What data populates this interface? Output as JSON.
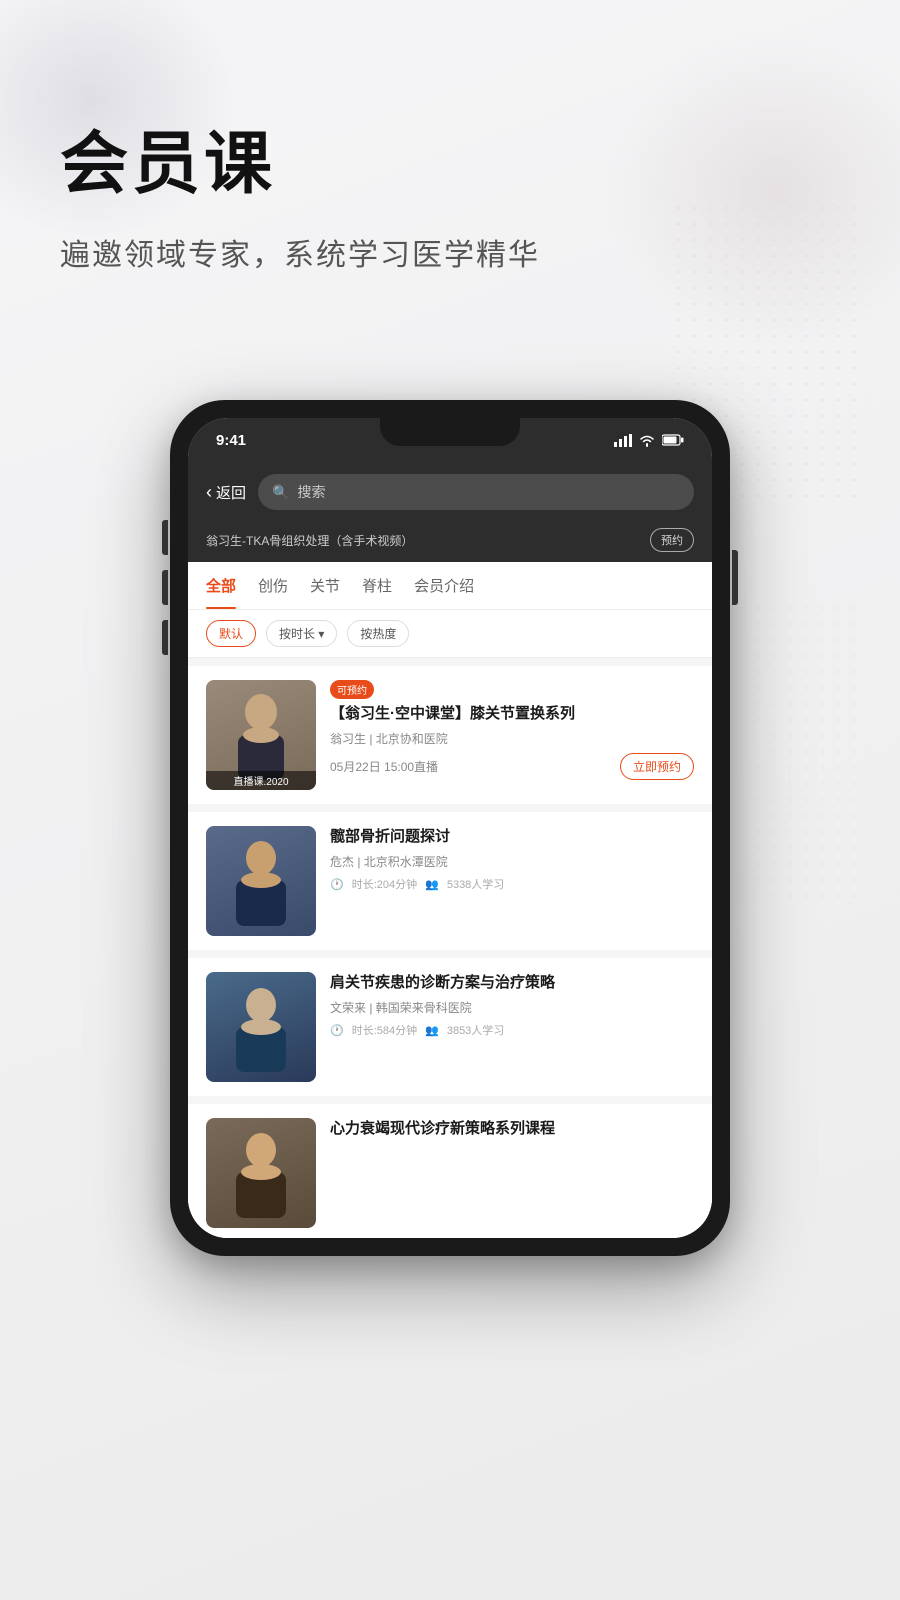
{
  "page": {
    "background_color": "#ebebeb"
  },
  "hero": {
    "title": "会员课",
    "subtitle": "遍邀领域专家，系统学习医学精华"
  },
  "phone": {
    "status_bar": {
      "time": "9:41",
      "signal": "signal-icon",
      "wifi": "wifi-icon",
      "battery": "battery-icon"
    },
    "nav": {
      "back_label": "返回",
      "search_placeholder": "搜索"
    },
    "breadcrumb": "翁习生-TKA骨组织处理（含手术视频）",
    "reserve_label": "预约",
    "tabs": [
      {
        "label": "全部",
        "active": true
      },
      {
        "label": "创伤",
        "active": false
      },
      {
        "label": "关节",
        "active": false
      },
      {
        "label": "脊柱",
        "active": false
      },
      {
        "label": "会员介绍",
        "active": false
      }
    ],
    "filters": [
      {
        "label": "默认",
        "active": true
      },
      {
        "label": "按时长 ▾",
        "active": false
      },
      {
        "label": "按热度",
        "active": false
      }
    ],
    "courses": [
      {
        "id": 1,
        "tag": "可预约",
        "title": "【翁习生·空中课堂】膝关节置换系列",
        "author": "翁习生 | 北京协和医院",
        "live_time": "05月22日 15:00直播",
        "thumb_label": "直播课.2020",
        "btn_label": "立即预约",
        "avatar_color": "#8a8078"
      },
      {
        "id": 2,
        "tag": "",
        "title": "髋部骨折问题探讨",
        "author": "危杰 | 北京积水潭医院",
        "duration": "时长:204分钟",
        "learners": "5338人学习",
        "thumb_label": "",
        "avatar_color": "#4a5a7a"
      },
      {
        "id": 3,
        "tag": "",
        "title": "肩关节疾患的诊断方案与治疗策略",
        "author": "文荣来 | 韩国荣来骨科医院",
        "duration": "时长:584分钟",
        "learners": "3853人学习",
        "thumb_label": "",
        "avatar_color": "#3a4a6a"
      },
      {
        "id": 4,
        "tag": "",
        "title": "心力衰竭现代诊疗新策略系列课程",
        "author": "",
        "duration": "",
        "learners": "",
        "thumb_label": "",
        "avatar_color": "#5a4a3a"
      }
    ]
  }
}
